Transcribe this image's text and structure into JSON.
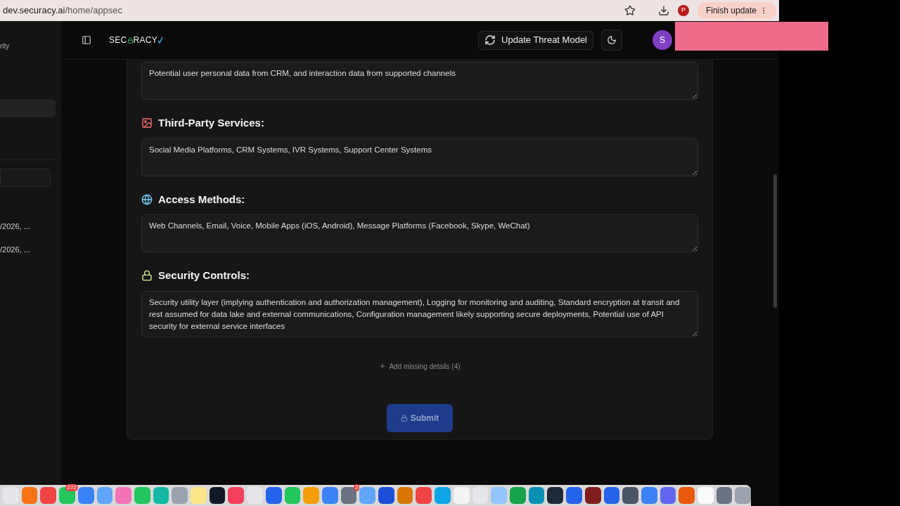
{
  "browser": {
    "url_host": "dev.securacy.ai",
    "url_path": "/home/appsec",
    "profile_initial": "P",
    "update_button": "Finish update"
  },
  "sidebar": {
    "items": [
      {
        "label": "rity"
      },
      {
        "label": "/2026, ..."
      },
      {
        "label": "/2026, ..."
      }
    ]
  },
  "header": {
    "logo": "SEC",
    "logo_rest": "RACY",
    "update_button": "Update Threat Model",
    "avatar_initial": "S"
  },
  "sections": [
    {
      "value": "Potential user personal data from CRM, and interaction data from supported channels"
    },
    {
      "heading": "Third-Party Services:",
      "value": "Social Media Platforms, CRM Systems, IVR Systems, Support Center Systems"
    },
    {
      "heading": "Access Methods:",
      "value": "Web Channels, Email, Voice, Mobile Apps (iOS, Android), Message Platforms (Facebook, Skype, WeChat)"
    },
    {
      "heading": "Security Controls:",
      "value": "Security utility layer (implying authentication and authorization management), Logging for monitoring and auditing, Standard encryption at transit and rest assumed for data lake and external communications, Configuration management likely supporting secure deployments, Potential use of API security for external service interfaces"
    }
  ],
  "add_details": "Add missing details (4)",
  "submit": {
    "label": "Submit",
    "disabled": true
  },
  "dock_badges": [
    "272",
    "2"
  ]
}
